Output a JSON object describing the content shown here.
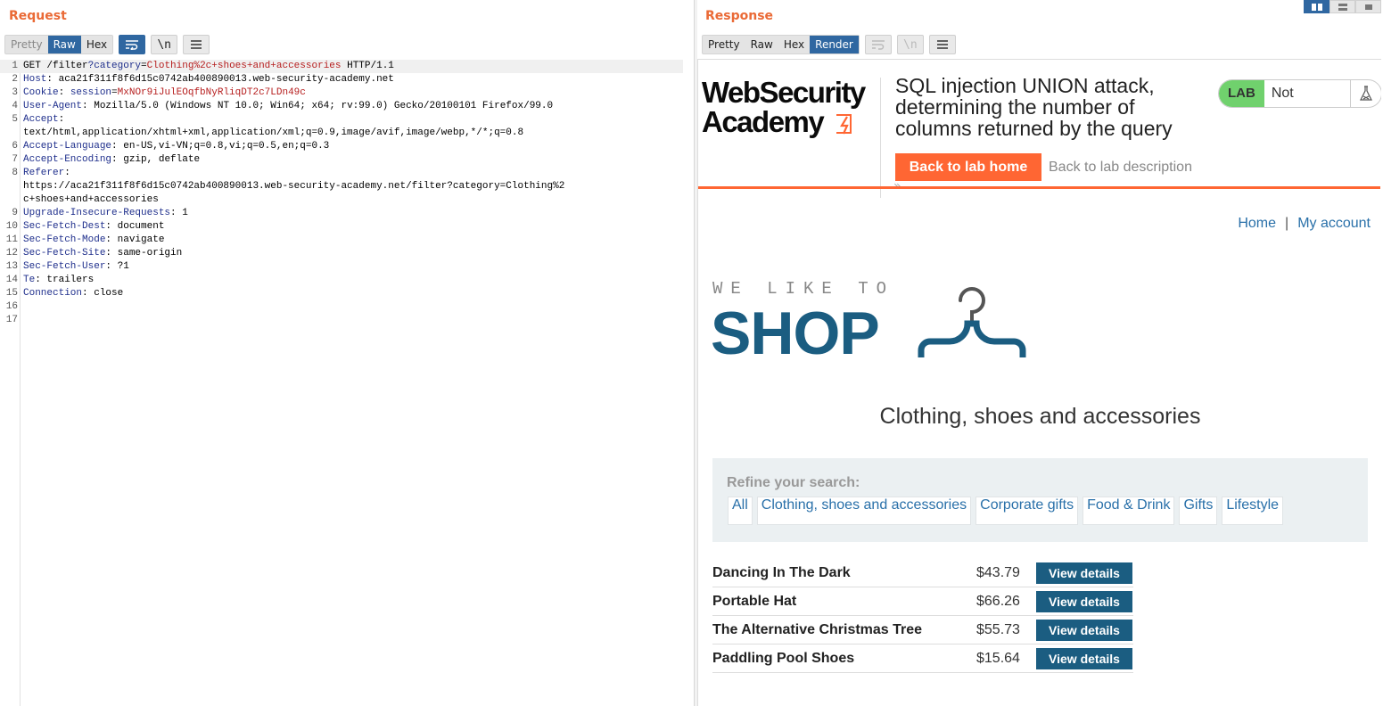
{
  "request": {
    "title": "Request",
    "tabs": [
      {
        "label": "Pretty",
        "state": "dim"
      },
      {
        "label": "Raw",
        "state": "active"
      },
      {
        "label": "Hex",
        "state": "normal"
      }
    ],
    "newline_label": "\\n",
    "lines": [
      {
        "num": "1",
        "parts": [
          {
            "t": "GET /filter",
            "c": "hv"
          },
          {
            "t": "?category",
            "c": "pk"
          },
          {
            "t": "=",
            "c": "hv"
          },
          {
            "t": "Clothing%2c+shoes+and+accessories",
            "c": "pv"
          },
          {
            "t": " HTTP/1.1",
            "c": "hv"
          }
        ]
      },
      {
        "num": "2",
        "parts": [
          {
            "t": "Host",
            "c": "hk"
          },
          {
            "t": ": aca21f311f8f6d15c0742ab400890013.web-security-academy.net",
            "c": "hv"
          }
        ]
      },
      {
        "num": "3",
        "parts": [
          {
            "t": "Cookie",
            "c": "hk"
          },
          {
            "t": ": ",
            "c": "hv"
          },
          {
            "t": "session",
            "c": "pk"
          },
          {
            "t": "=",
            "c": "hv"
          },
          {
            "t": "MxNOr9iJulEOqfbNyRliqDT2c7LDn49c",
            "c": "pv"
          }
        ]
      },
      {
        "num": "4",
        "parts": [
          {
            "t": "User-Agent",
            "c": "hk"
          },
          {
            "t": ": Mozilla/5.0 (Windows NT 10.0; Win64; x64; rv:99.0) Gecko/20100101 Firefox/99.0",
            "c": "hv"
          }
        ]
      },
      {
        "num": "5",
        "parts": [
          {
            "t": "Accept",
            "c": "hk"
          },
          {
            "t": ":",
            "c": "hv"
          }
        ]
      },
      {
        "num": "",
        "parts": [
          {
            "t": "text/html,application/xhtml+xml,application/xml;q=0.9,image/avif,image/webp,*/*;q=0.8",
            "c": "hv"
          }
        ]
      },
      {
        "num": "6",
        "parts": [
          {
            "t": "Accept-Language",
            "c": "hk"
          },
          {
            "t": ": en-US,vi-VN;q=0.8,vi;q=0.5,en;q=0.3",
            "c": "hv"
          }
        ]
      },
      {
        "num": "7",
        "parts": [
          {
            "t": "Accept-Encoding",
            "c": "hk"
          },
          {
            "t": ": gzip, deflate",
            "c": "hv"
          }
        ]
      },
      {
        "num": "8",
        "parts": [
          {
            "t": "Referer",
            "c": "hk"
          },
          {
            "t": ":",
            "c": "hv"
          }
        ]
      },
      {
        "num": "",
        "parts": [
          {
            "t": "https://aca21f311f8f6d15c0742ab400890013.web-security-academy.net/filter?category=Clothing%2",
            "c": "hv"
          }
        ]
      },
      {
        "num": "",
        "parts": [
          {
            "t": "c+shoes+and+accessories",
            "c": "hv"
          }
        ]
      },
      {
        "num": "9",
        "parts": [
          {
            "t": "Upgrade-Insecure-Requests",
            "c": "hk"
          },
          {
            "t": ": 1",
            "c": "hv"
          }
        ]
      },
      {
        "num": "10",
        "parts": [
          {
            "t": "Sec-Fetch-Dest",
            "c": "hk"
          },
          {
            "t": ": document",
            "c": "hv"
          }
        ]
      },
      {
        "num": "11",
        "parts": [
          {
            "t": "Sec-Fetch-Mode",
            "c": "hk"
          },
          {
            "t": ": navigate",
            "c": "hv"
          }
        ]
      },
      {
        "num": "12",
        "parts": [
          {
            "t": "Sec-Fetch-Site",
            "c": "hk"
          },
          {
            "t": ": same-origin",
            "c": "hv"
          }
        ]
      },
      {
        "num": "13",
        "parts": [
          {
            "t": "Sec-Fetch-User",
            "c": "hk"
          },
          {
            "t": ": ?1",
            "c": "hv"
          }
        ]
      },
      {
        "num": "14",
        "parts": [
          {
            "t": "Te",
            "c": "hk"
          },
          {
            "t": ": trailers",
            "c": "hv"
          }
        ]
      },
      {
        "num": "15",
        "parts": [
          {
            "t": "Connection",
            "c": "hk"
          },
          {
            "t": ": close",
            "c": "hv"
          }
        ]
      },
      {
        "num": "16",
        "parts": []
      },
      {
        "num": "17",
        "parts": []
      }
    ]
  },
  "response": {
    "title": "Response",
    "tabs": [
      {
        "label": "Pretty",
        "state": "normal"
      },
      {
        "label": "Raw",
        "state": "normal"
      },
      {
        "label": "Hex",
        "state": "normal"
      },
      {
        "label": "Render",
        "state": "active"
      }
    ],
    "newline_label": "\\n"
  },
  "rendered": {
    "logo_line1": "WebSecurity",
    "logo_line2": "Academy",
    "lab_title": "SQL injection UNION attack, determining the number of columns returned by the query",
    "lab_badge": "LAB",
    "lab_state": "Not solved",
    "back_home": "Back to lab home",
    "back_desc": "Back to lab description",
    "nav": {
      "home": "Home",
      "sep": "|",
      "account": "My account"
    },
    "shop_tag": "WE LIKE TO",
    "shop_word": "SHOP",
    "heading": "Clothing, shoes and accessories",
    "refine_label": "Refine your search:",
    "filters": [
      "All",
      "Clothing, shoes and accessories",
      "Corporate gifts",
      "Food & Drink",
      "Gifts",
      "Lifestyle"
    ],
    "products": [
      {
        "name": "Dancing In The Dark",
        "price": "$43.79",
        "button": "View details"
      },
      {
        "name": "Portable Hat",
        "price": "$66.26",
        "button": "View details"
      },
      {
        "name": "The Alternative Christmas Tree",
        "price": "$55.73",
        "button": "View details"
      },
      {
        "name": "Paddling Pool Shoes",
        "price": "$15.64",
        "button": "View details"
      }
    ]
  },
  "colors": {
    "accent": "#ea6a36",
    "burp_blue": "#2f67a1",
    "shop_blue": "#1b5d81",
    "lab_orange": "#ff6633",
    "lab_green": "#70d16d"
  },
  "icons": [
    "wrap-lines-icon",
    "newline-icon",
    "menu-icon",
    "layout-split-icon",
    "layout-horizontal-icon",
    "layout-single-icon",
    "flask-icon",
    "hanger-icon",
    "bolt-icon"
  ]
}
